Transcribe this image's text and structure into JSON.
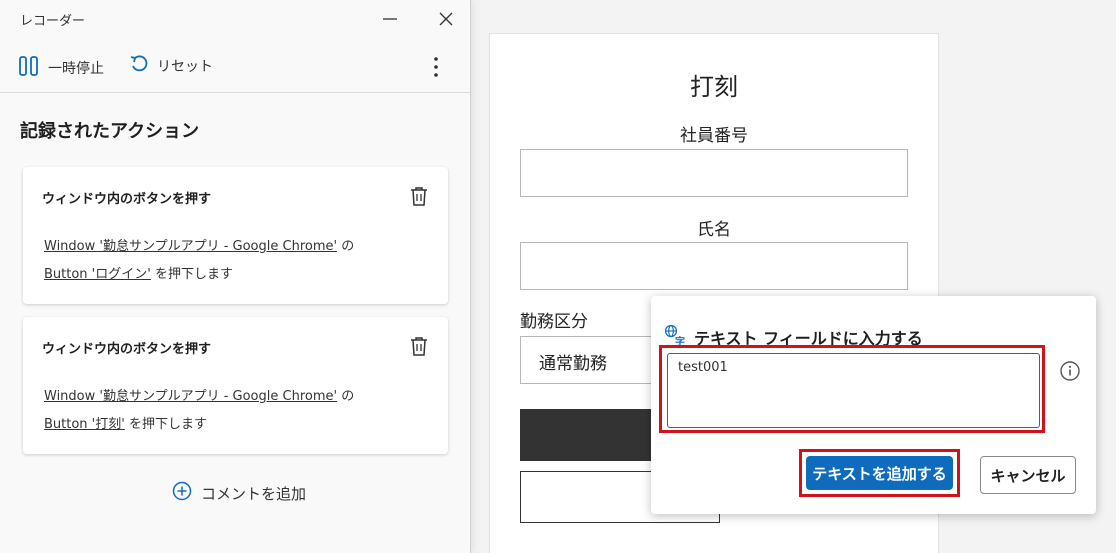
{
  "form": {
    "title": "打刻",
    "employee_number_label": "社員番号",
    "name_label": "氏名",
    "work_type_label": "勤務区分",
    "work_type_value": "通常勤務"
  },
  "recorder": {
    "window_title": "レコーダー",
    "toolbar": {
      "pause_label": "一時停止",
      "reset_label": "リセット"
    },
    "section_heading": "記録されたアクション",
    "actions": [
      {
        "title": "ウィンドウ内のボタンを押す",
        "window_link": "Window '勤怠サンプルアプリ - Google Chrome'",
        "window_suffix": "の",
        "button_link": "Button 'ログイン'",
        "button_suffix": "を押下します"
      },
      {
        "title": "ウィンドウ内のボタンを押す",
        "window_link": "Window '勤怠サンプルアプリ - Google Chrome'",
        "window_suffix": "の",
        "button_link": "Button '打刻'",
        "button_suffix": "を押下します"
      }
    ],
    "add_comment_label": "コメントを追加"
  },
  "popup": {
    "title": "テキスト フィールドに入力する",
    "input_value": "test001",
    "add_button_label": "テキストを追加する",
    "cancel_button_label": "キャンセル"
  },
  "icons": [
    "pause-icon",
    "reset-icon",
    "more-options-icon",
    "minimize-icon",
    "close-icon",
    "trash-icon",
    "add-comment-icon",
    "translate-icon",
    "info-icon"
  ],
  "colors": {
    "accent": "#0f6cbd",
    "highlight": "#d0121b",
    "dark_button": "#333333"
  }
}
